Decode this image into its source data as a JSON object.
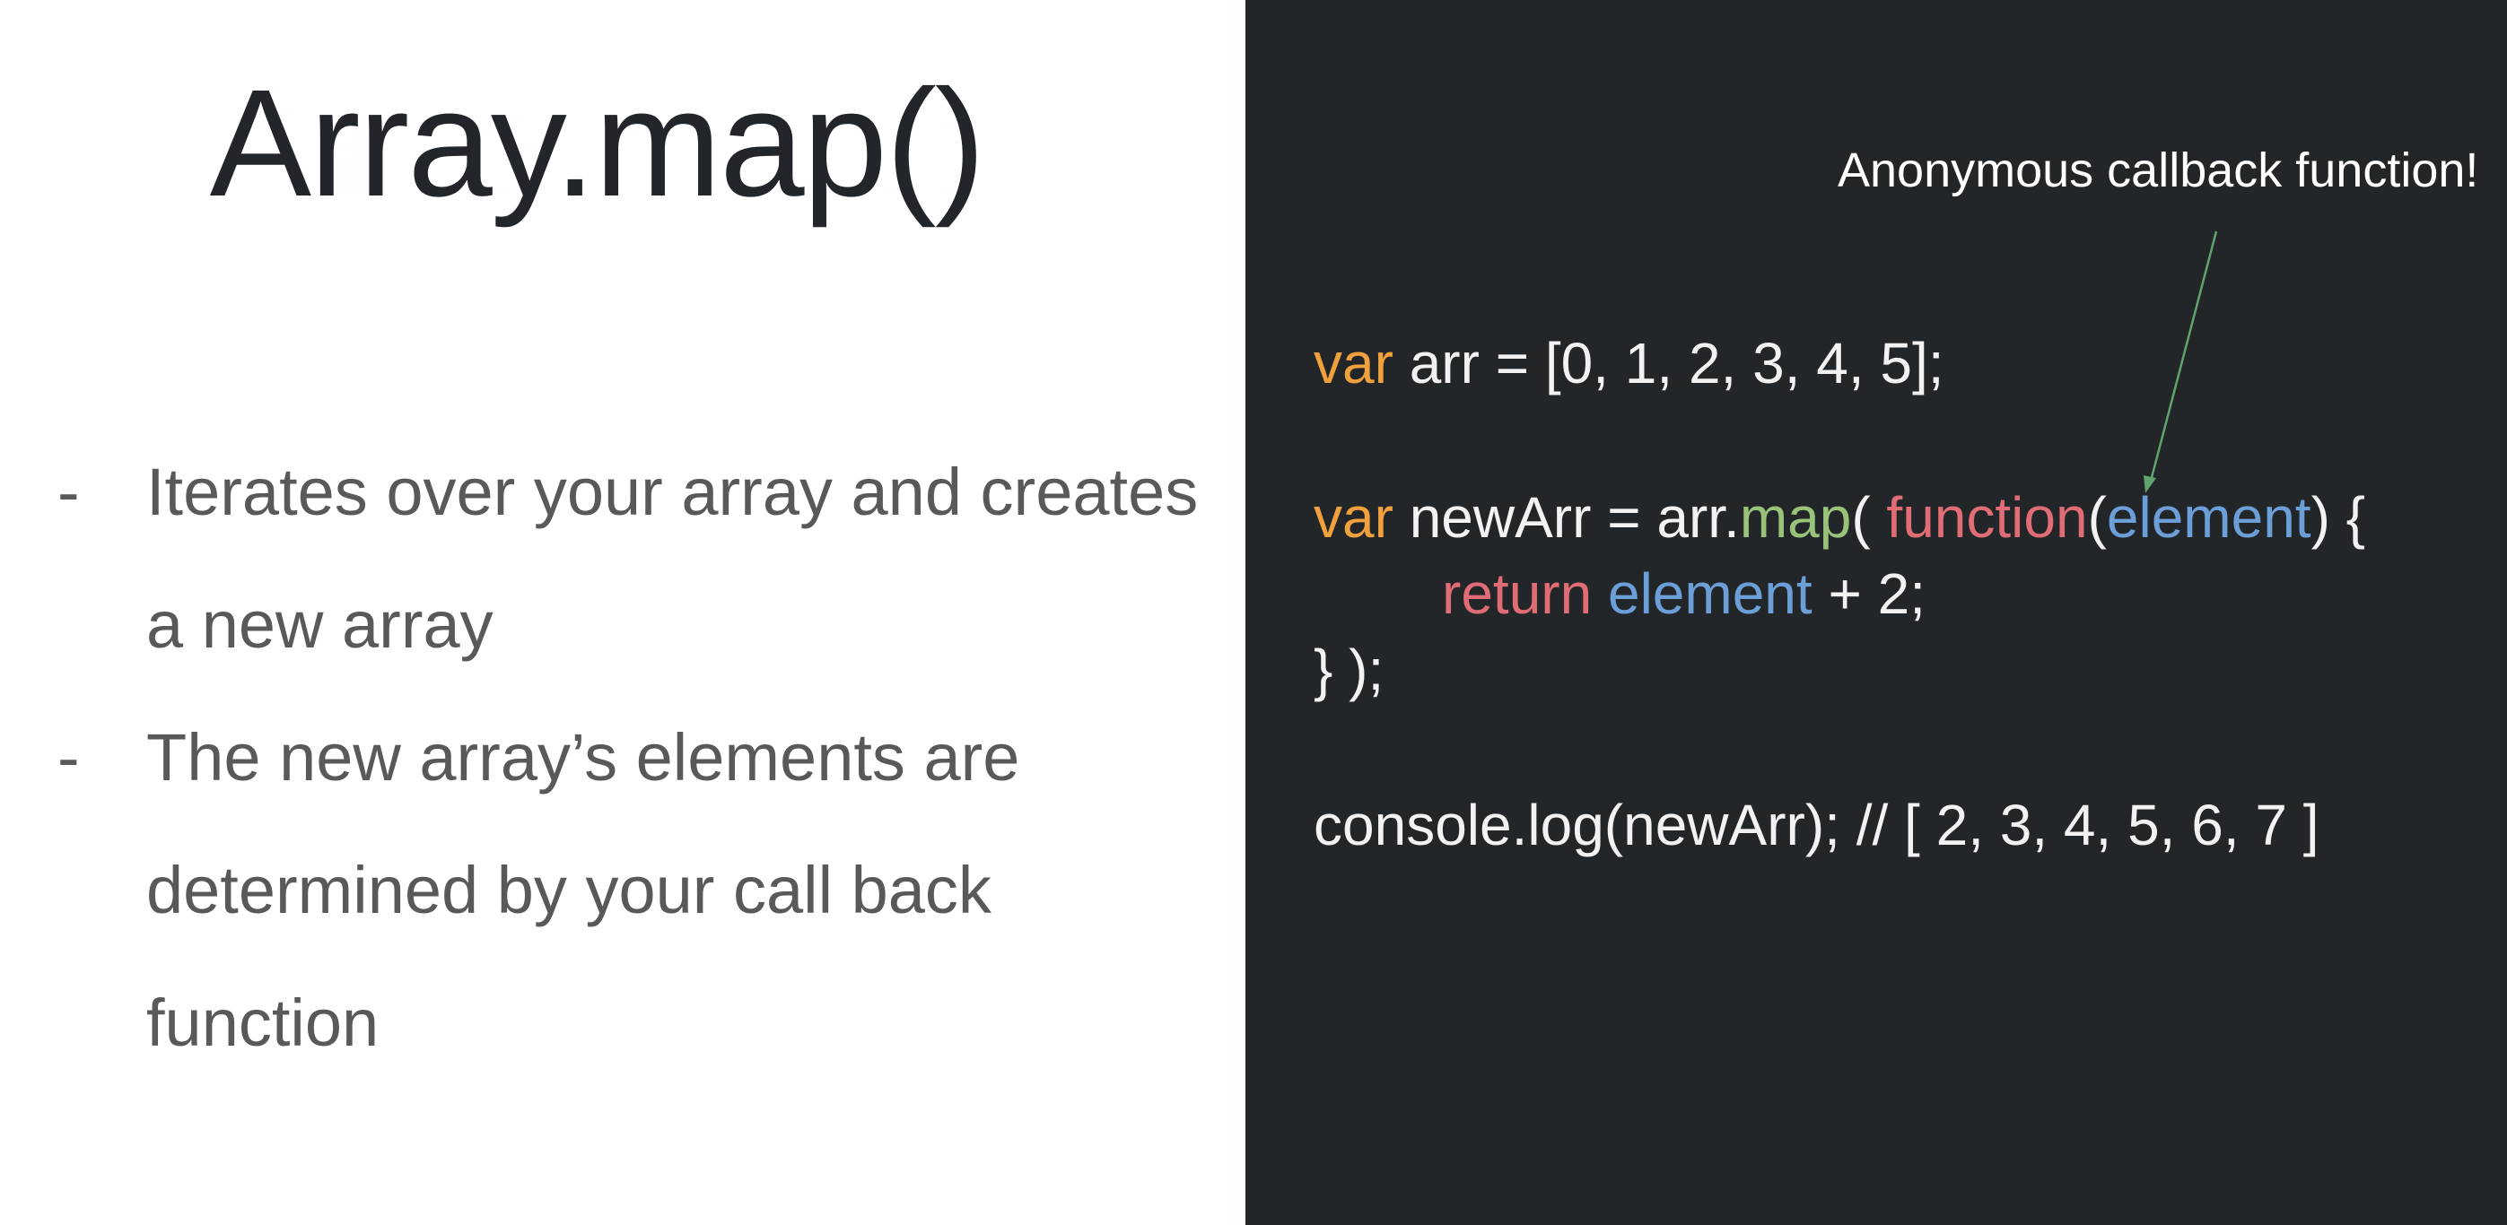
{
  "title": "Array.map()",
  "bullets": [
    {
      "dash": "-",
      "text": "Iterates over your array and creates a new array"
    },
    {
      "dash": "-",
      "text": "The new array’s elements are determined by your call back function"
    }
  ],
  "annotation": "Anonymous callback function!",
  "colors": {
    "left_bg": "#ffffff",
    "right_bg": "#222629",
    "keyword_var": "#f0a03c",
    "method": "#98c379",
    "function_keyword": "#e06c75",
    "parameter": "#6c9fd8",
    "arrow": "#5fa36e"
  },
  "code": {
    "line1": {
      "kw": "var",
      "rest": " arr = [0, 1, 2, 3, 4, 5];"
    },
    "line2": {
      "kw": "var",
      "a": " newArr = arr.",
      "method": "map",
      "b": "( ",
      "func": "function",
      "c": "(",
      "param": "element",
      "d": ") {"
    },
    "line3": {
      "ret": "return",
      "sp": " ",
      "param": "element",
      "rest": " + 2;"
    },
    "line4": {
      "text": "} );"
    },
    "line5": {
      "text": "console.log(newArr); // [ 2, 3, 4, 5, 6, 7 ]"
    }
  }
}
